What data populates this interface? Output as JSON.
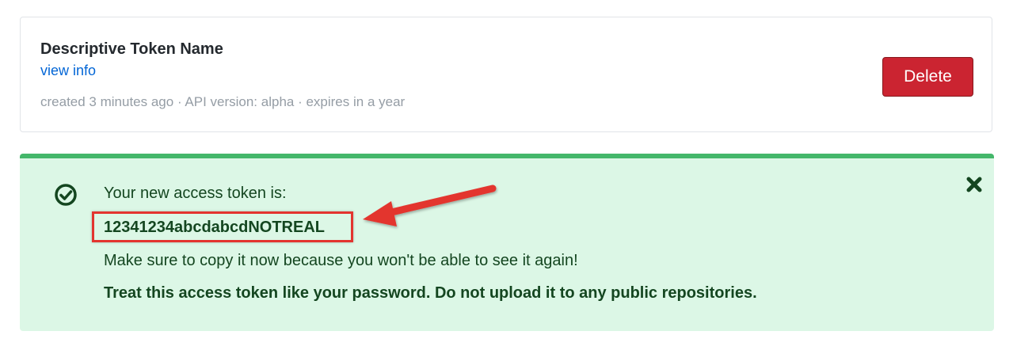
{
  "token": {
    "name": "Descriptive Token Name",
    "view_info_label": "view info",
    "meta": "created 3 minutes ago · API version: alpha · expires in a year",
    "delete_label": "Delete"
  },
  "flash": {
    "intro": "Your new access token is:",
    "token_value": "12341234abcdabcdNOTREAL",
    "copy_note": "Make sure to copy it now because you won't be able to see it again!",
    "warning": "Treat this access token like your password. Do not upload it to any public repositories."
  },
  "icons": {
    "success": "check-circle-icon",
    "dismiss": "close-icon",
    "annotation": "red-arrow-icon"
  },
  "colors": {
    "delete_button": "#cb2431",
    "link": "#0366d6",
    "flash_background": "#dcf7e6",
    "flash_border": "#44b76a",
    "flash_text": "#144620",
    "annotation_red": "#e3342f"
  }
}
